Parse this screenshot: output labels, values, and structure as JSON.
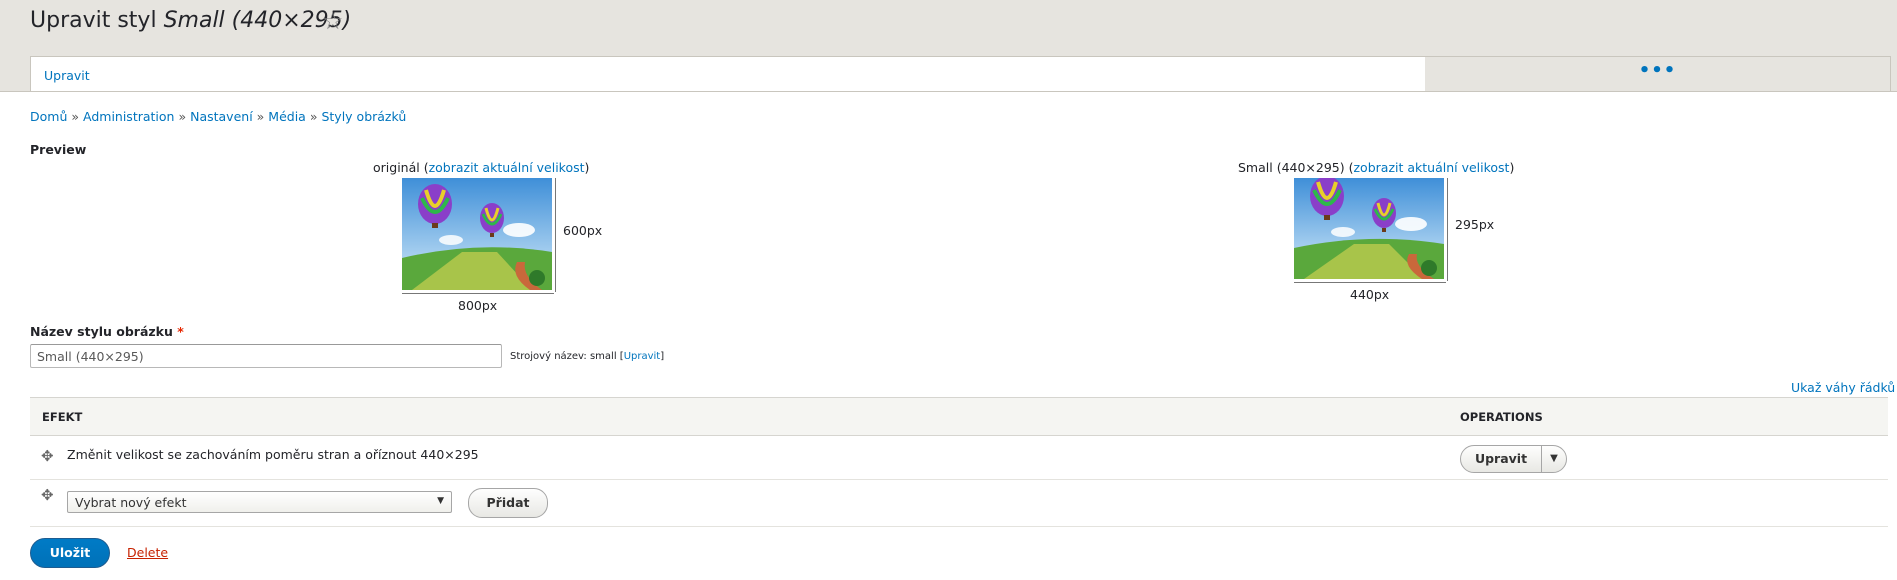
{
  "header": {
    "title_prefix": "Upravit styl ",
    "title_style": "Small (440×295)",
    "star_icon": "☆",
    "tabs": {
      "edit_label": "Upravit",
      "more_label": "•••"
    }
  },
  "breadcrumb": [
    {
      "label": "Domů"
    },
    {
      "label": "Administration"
    },
    {
      "label": "Nastavení"
    },
    {
      "label": "Média"
    },
    {
      "label": "Styly obrázků"
    }
  ],
  "breadcrumb_separator": "»",
  "preview": {
    "label": "Preview",
    "original": {
      "caption_prefix": "originál (",
      "caption_link": "zobrazit aktuální velikost",
      "caption_suffix": ")",
      "width_label": "800px",
      "height_label": "600px"
    },
    "derivative": {
      "caption_prefix": "Small (440×295) (",
      "caption_link": "zobrazit aktuální velikost",
      "caption_suffix": ")",
      "width_label": "440px",
      "height_label": "295px"
    }
  },
  "form": {
    "name_label": "Název stylu obrázku",
    "required_mark": "*",
    "name_value": "Small (440×295)",
    "machine_prefix": "Strojový název: small [",
    "machine_link": "Upravit",
    "machine_suffix": "]"
  },
  "table": {
    "show_weights": "Ukaž váhy řádků",
    "headers": {
      "effect": "EFEKT",
      "operations": "OPERATIONS"
    },
    "rows": [
      {
        "effect": "Změnit velikost se zachováním poměru stran a oříznout 440×295",
        "operation": "Upravit"
      }
    ],
    "new_effect": {
      "selected": "Vybrat nový efekt",
      "add_label": "Přidat"
    }
  },
  "actions": {
    "save_label": "Uložit",
    "delete_label": "Delete"
  },
  "colors": {
    "link": "#0074bd",
    "primary": "#0071b8",
    "danger": "#c72100",
    "header_bg": "#e6e4df"
  },
  "icons": {
    "drag_handle": "drag-handle-icon",
    "star": "star-outline-icon",
    "select_arrow": "chevron-down-icon"
  }
}
